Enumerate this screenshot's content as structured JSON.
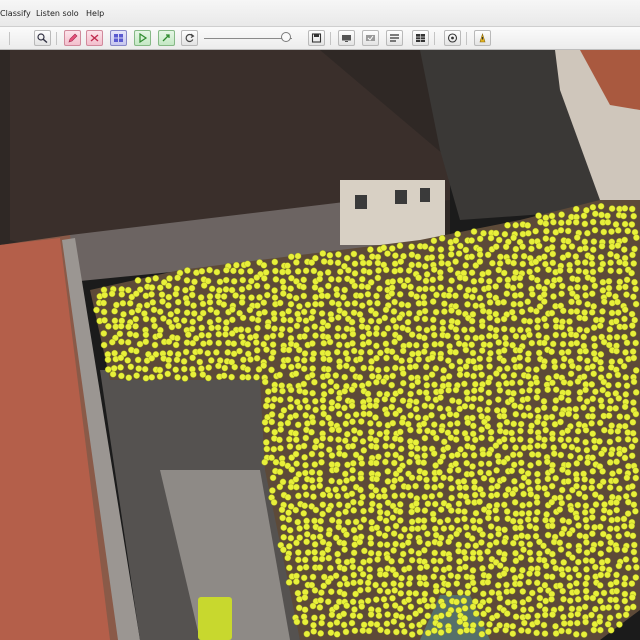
{
  "menu": [
    "Classify",
    "Listen solo",
    "Help"
  ],
  "toolbar": {
    "buttons": [
      {
        "icon": "zoom-icon",
        "glyph": "🔍",
        "style": "plain"
      },
      {
        "icon": "annotate-icon",
        "glyph": "✎",
        "style": "pink"
      },
      {
        "icon": "erase-icon",
        "glyph": "✕",
        "style": "pink"
      },
      {
        "icon": "grid-icon",
        "glyph": "▦",
        "style": "blue"
      },
      {
        "icon": "play-icon",
        "glyph": "▷",
        "style": "green"
      },
      {
        "icon": "auto-detect-icon",
        "glyph": "↗",
        "style": "green"
      },
      {
        "icon": "refresh-icon",
        "glyph": "↻",
        "style": "plain"
      },
      {
        "icon": "save-icon",
        "glyph": "▤",
        "style": "plain"
      },
      {
        "icon": "display-icon",
        "glyph": "▭",
        "style": "plain"
      },
      {
        "icon": "overlay-icon",
        "glyph": "▬",
        "style": "plain"
      },
      {
        "icon": "list-icon",
        "glyph": "≡",
        "style": "plain"
      },
      {
        "icon": "table-icon",
        "glyph": "▦",
        "style": "plain"
      },
      {
        "icon": "target-icon",
        "glyph": "◎",
        "style": "plain"
      },
      {
        "icon": "info-icon",
        "glyph": "ℹ",
        "style": "plain"
      }
    ],
    "zoom_slider_value": 0.93
  },
  "image": {
    "content": "Aerial photograph of a town square filled with a crowd; individual heads are marked with yellow detection dots",
    "marker_color": "#e8f03a"
  }
}
